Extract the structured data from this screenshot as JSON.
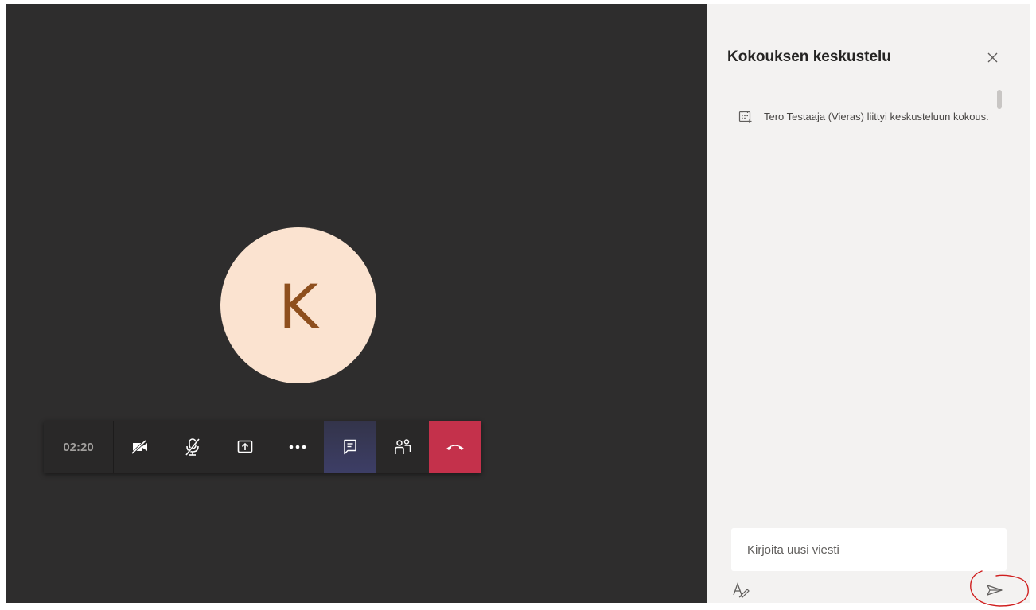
{
  "call": {
    "timer": "02:20",
    "participant_initial": "K",
    "avatar_color": "#fbe3d0",
    "avatar_text_color": "#8e4f1d",
    "toolbar": [
      {
        "name": "camera-off-button",
        "icon": "camera-off-icon"
      },
      {
        "name": "mic-off-button",
        "icon": "mic-off-icon"
      },
      {
        "name": "share-screen-button",
        "icon": "share-screen-icon"
      },
      {
        "name": "more-actions-button",
        "icon": "more-icon"
      },
      {
        "name": "chat-button",
        "icon": "chat-icon",
        "active": true
      },
      {
        "name": "participants-button",
        "icon": "participants-icon"
      },
      {
        "name": "hang-up-button",
        "icon": "phone-hangup-icon",
        "color": "#c4314b"
      }
    ]
  },
  "chat": {
    "title": "Kokouksen keskustelu",
    "messages": [
      {
        "icon": "calendar-join-icon",
        "author": "Tero Testaaja (Vieras)",
        "text": " liittyi keskusteluun kokous."
      }
    ],
    "compose_placeholder": "Kirjoita uusi viesti",
    "annotation_color": "#d01f1f"
  }
}
